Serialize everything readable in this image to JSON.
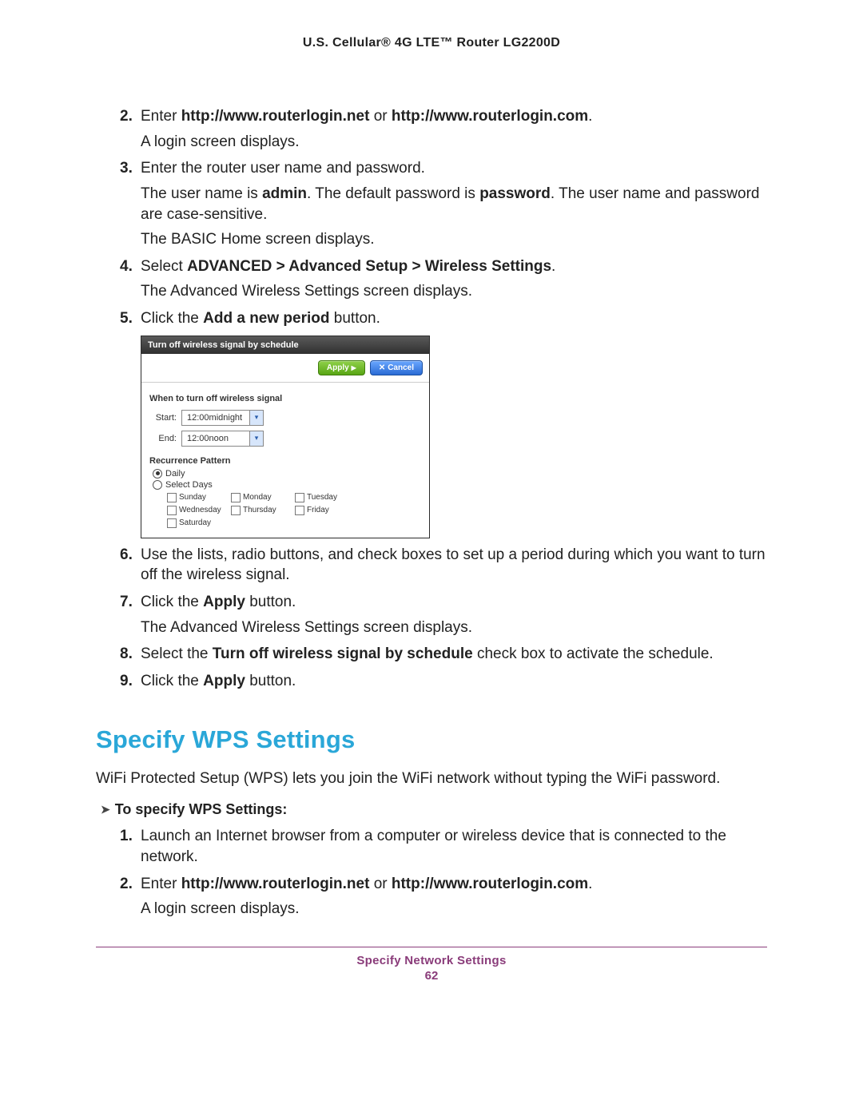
{
  "doc": {
    "header": "U.S. Cellular® 4G LTE™ Router LG2200D",
    "footer_section": "Specify Network Settings",
    "page_number": "62"
  },
  "steps": {
    "s2_num": "2.",
    "s2_a": "Enter ",
    "s2_b": "http://www.routerlogin.net",
    "s2_c": " or ",
    "s2_d": "http://www.routerlogin.com",
    "s2_e": ".",
    "s2_sub": "A login screen displays.",
    "s3_num": "3.",
    "s3": "Enter the router user name and password.",
    "s3_sub1a": "The user name is ",
    "s3_sub1b": "admin",
    "s3_sub1c": ". The default password is ",
    "s3_sub1d": "password",
    "s3_sub1e": ". The user name and password are case-sensitive.",
    "s3_sub2": "The BASIC Home screen displays.",
    "s4_num": "4.",
    "s4_a": "Select ",
    "s4_b": "ADVANCED > Advanced Setup > Wireless Settings",
    "s4_c": ".",
    "s4_sub": "The Advanced Wireless Settings screen displays.",
    "s5_num": "5.",
    "s5_a": "Click the ",
    "s5_b": "Add a new period",
    "s5_c": " button.",
    "s6_num": "6.",
    "s6": "Use the lists, radio buttons, and check boxes to set up a period during which you want to turn off the wireless signal.",
    "s7_num": "7.",
    "s7_a": "Click the ",
    "s7_b": "Apply",
    "s7_c": " button.",
    "s7_sub": "The Advanced Wireless Settings screen displays.",
    "s8_num": "8.",
    "s8_a": "Select the ",
    "s8_b": "Turn off wireless signal by schedule",
    "s8_c": " check box to activate the schedule.",
    "s9_num": "9.",
    "s9_a": "Click the ",
    "s9_b": "Apply",
    "s9_c": " button."
  },
  "shot": {
    "title": "Turn off wireless signal by schedule",
    "apply": "Apply",
    "cancel": "Cancel",
    "when_label": "When to turn off wireless signal",
    "start_label": "Start:",
    "start_value": "12:00midnight",
    "end_label": "End:",
    "end_value": "12:00noon",
    "recur_header": "Recurrence Pattern",
    "daily": "Daily",
    "select_days": "Select Days",
    "days": [
      "Sunday",
      "Monday",
      "Tuesday",
      "Wednesday",
      "Thursday",
      "Friday",
      "Saturday"
    ]
  },
  "wps": {
    "heading": "Specify WPS Settings",
    "intro": "WiFi Protected Setup (WPS) lets you join the WiFi network without typing the WiFi password.",
    "proc_label": "To specify WPS Settings:",
    "s1_num": "1.",
    "s1": "Launch an Internet browser from a computer or wireless device that is connected to the network.",
    "s2_num": "2.",
    "s2_a": "Enter ",
    "s2_b": "http://www.routerlogin.net",
    "s2_c": " or ",
    "s2_d": "http://www.routerlogin.com",
    "s2_e": ".",
    "s2_sub": "A login screen displays."
  }
}
